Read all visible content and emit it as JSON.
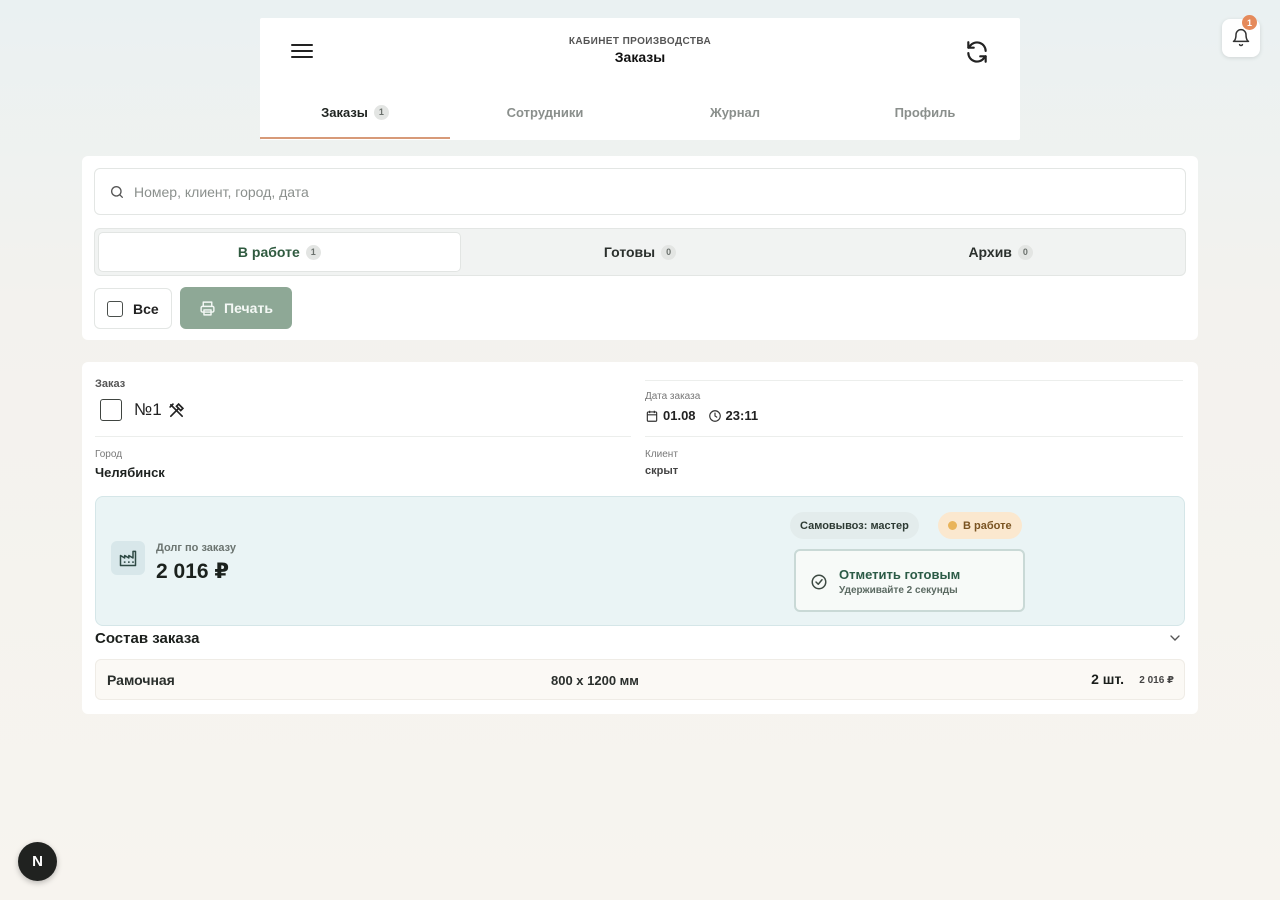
{
  "header": {
    "subtitle": "КАБИНЕТ ПРОИЗВОДСТВА",
    "title": "Заказы",
    "tabs": [
      {
        "label": "Заказы",
        "count": "1",
        "active": true
      },
      {
        "label": "Сотрудники"
      },
      {
        "label": "Журнал"
      },
      {
        "label": "Профиль"
      }
    ]
  },
  "notifications": {
    "count": "1"
  },
  "filters": {
    "search_placeholder": "Номер, клиент, город, дата",
    "segments": [
      {
        "label": "В работе",
        "count": "1",
        "active": true
      },
      {
        "label": "Готовы",
        "count": "0"
      },
      {
        "label": "Архив",
        "count": "0"
      }
    ],
    "all_label": "Все",
    "print_label": "Печать"
  },
  "order": {
    "number_label": "Заказ",
    "number": "№1",
    "date_label": "Дата заказа",
    "date": "01.08",
    "time": "23:11",
    "city_label": "Город",
    "city": "Челябинск",
    "client_label": "Клиент",
    "client": "скрыт",
    "debt_label": "Долг по заказу",
    "debt_value": "2 016 ₽",
    "pickup_chip": "Самовывоз: мастер",
    "status_chip": "В работе",
    "ready_title": "Отметить готовым",
    "ready_hint": "Удерживайте 2 секунды",
    "composition_title": "Состав заказа",
    "items": [
      {
        "name": "Рамочная",
        "size": "800 x 1200 мм",
        "qty": "2 шт.",
        "price": "2 016 ₽"
      }
    ]
  },
  "dev_badge": "N",
  "colors": {
    "accent_tab": "#d79a78",
    "print_button": "#8ea896",
    "debt_box": "#eaf4f5",
    "status_chip": "#fbe8cf",
    "notification_badge": "#e58a5b"
  }
}
